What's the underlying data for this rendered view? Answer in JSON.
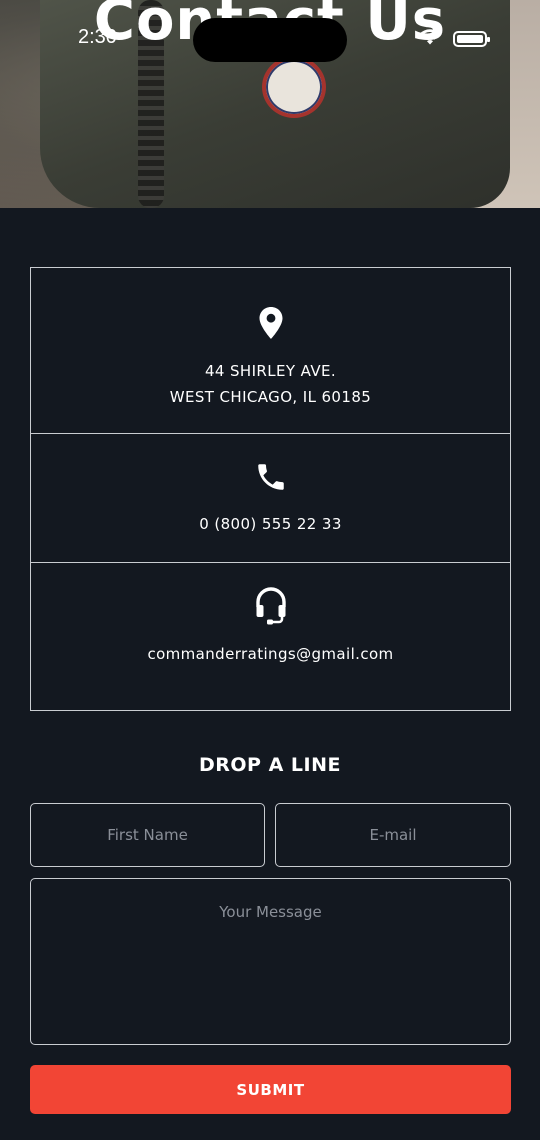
{
  "status_bar": {
    "time": "2:30"
  },
  "hero": {
    "title": "Contact Us"
  },
  "contact": {
    "address_line1": "44 SHIRLEY AVE.",
    "address_line2": "WEST CHICAGO, IL 60185",
    "phone": "0 (800) 555 22 33",
    "email": "commanderratings@gmail.com",
    "icons": [
      "location-pin-icon",
      "phone-icon",
      "headset-icon"
    ]
  },
  "form": {
    "title": "DROP A LINE",
    "first_name_placeholder": "First Name",
    "email_placeholder": "E-mail",
    "message_placeholder": "Your Message",
    "submit_label": "SUBMIT"
  },
  "colors": {
    "background": "#131820",
    "accent": "#f24535",
    "border": "#c9ccd1"
  }
}
